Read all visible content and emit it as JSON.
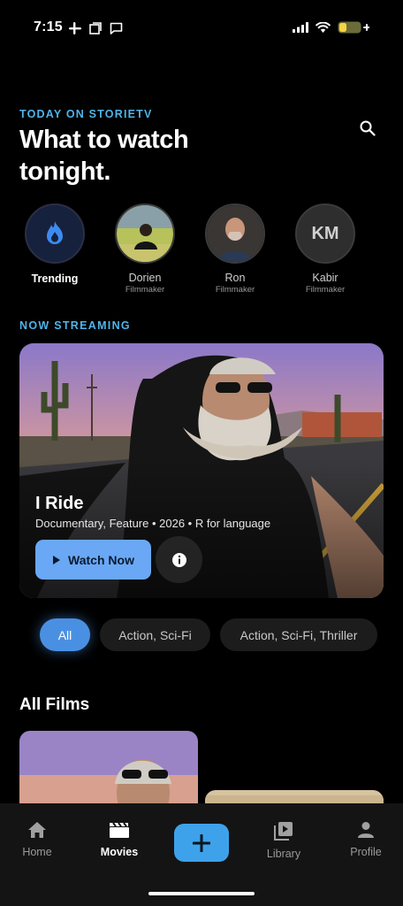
{
  "status_bar": {
    "time": "7:15"
  },
  "header": {
    "eyebrow": "TODAY ON STORIETV",
    "headline": "What to watch tonight."
  },
  "stories": [
    {
      "name": "Trending",
      "role": ""
    },
    {
      "name": "Dorien",
      "role": "Filmmaker"
    },
    {
      "name": "Ron",
      "role": "Filmmaker"
    },
    {
      "name": "Kabir",
      "role": "Filmmaker",
      "initials": "KM"
    }
  ],
  "now_streaming": {
    "label": "NOW STREAMING",
    "title": "I Ride",
    "meta": "Documentary, Feature • 2026 • R for language",
    "watch_label": "Watch Now"
  },
  "filters": [
    {
      "label": "All",
      "active": true
    },
    {
      "label": "Action, Sci-Fi",
      "active": false
    },
    {
      "label": "Action, Sci-Fi, Thriller",
      "active": false
    }
  ],
  "all_films": {
    "title": "All Films"
  },
  "tabbar": {
    "items": [
      {
        "label": "Home"
      },
      {
        "label": "Movies"
      },
      {
        "label": "Library"
      },
      {
        "label": "Profile"
      }
    ]
  },
  "colors": {
    "accent": "#4fb4ea",
    "primary_button": "#6aa8f5",
    "chip_active": "#4a90e2",
    "plus": "#3ea2ea"
  }
}
